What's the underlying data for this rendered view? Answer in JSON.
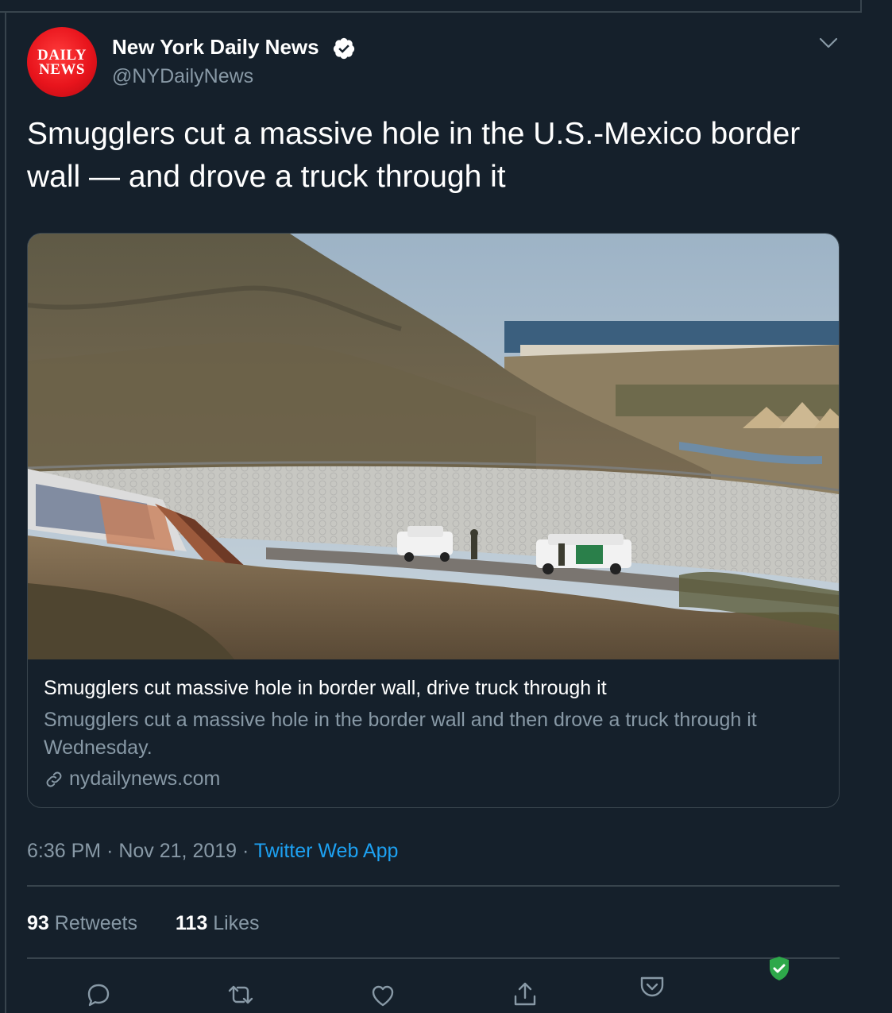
{
  "author": {
    "display_name": "New York Daily News",
    "handle": "@NYDailyNews",
    "avatar_text_line1": "DAILY",
    "avatar_text_line2": "NEWS"
  },
  "tweet": {
    "text": "Smugglers cut a massive hole in the U.S.-Mexico border wall — and drove a truck through it",
    "time": "6:36 PM",
    "separator": "·",
    "date": "Nov 21, 2019",
    "source": "Twitter Web App"
  },
  "card": {
    "title": "Smugglers cut massive hole in border wall, drive truck through it",
    "description": "Smugglers cut a massive hole in the border wall and then drove a truck through it Wednesday.",
    "domain": "nydailynews.com",
    "link_icon": "link-icon"
  },
  "stats": {
    "retweets_count": "93",
    "retweets_label": "Retweets",
    "likes_count": "113",
    "likes_label": "Likes"
  },
  "actions": [
    "reply-icon",
    "retweet-icon",
    "like-icon",
    "share-icon",
    "pocket-icon"
  ],
  "colors": {
    "background": "#15202b",
    "border": "#38444d",
    "secondary_text": "#8899a6",
    "accent": "#1da1f2",
    "avatar_red": "#e8141c",
    "shield_green": "#2ea84a"
  }
}
